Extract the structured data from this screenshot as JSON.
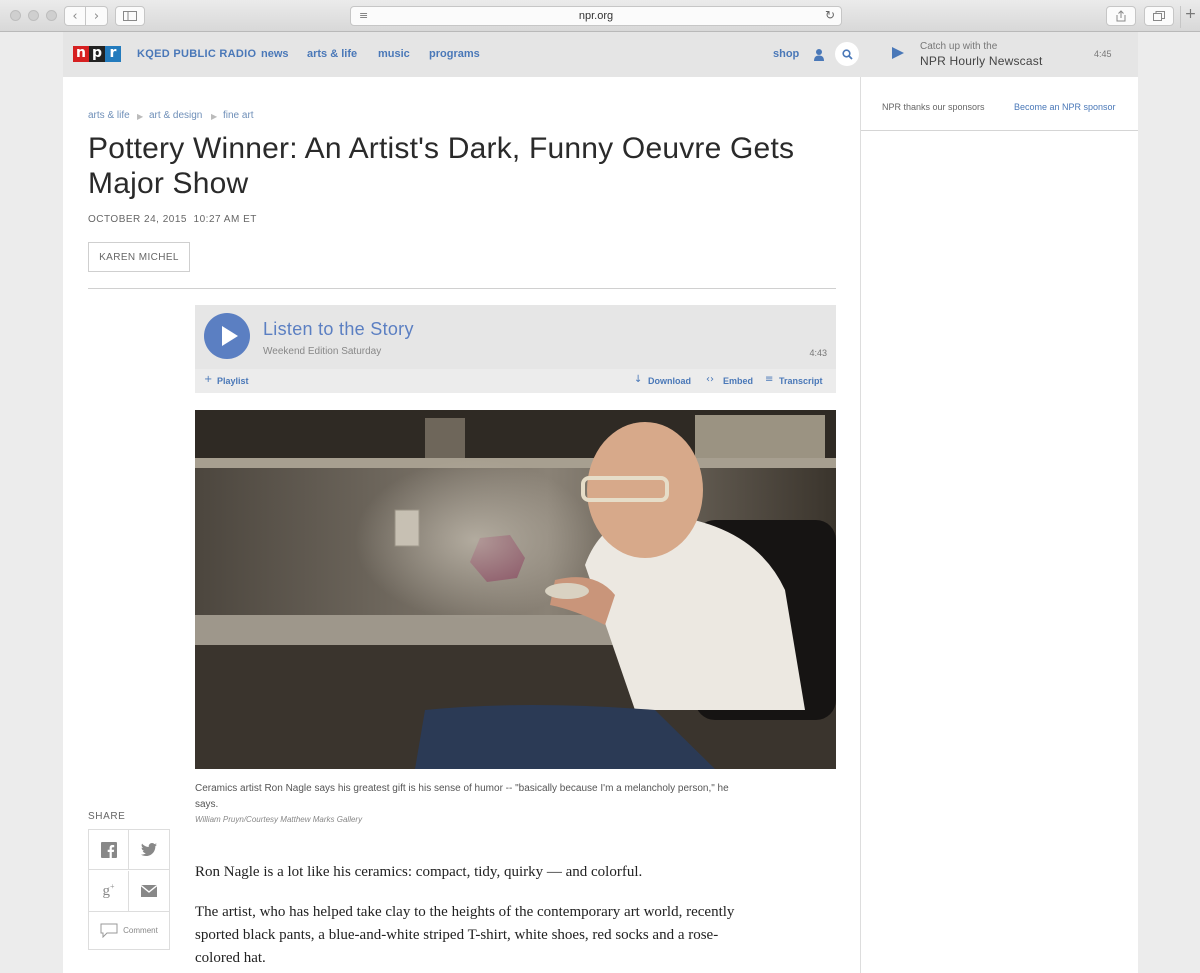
{
  "browser": {
    "url": "npr.org"
  },
  "nav": {
    "station": "KQED PUBLIC RADIO",
    "links": [
      "news",
      "arts & life",
      "music",
      "programs"
    ],
    "shop": "shop",
    "newscast_kicker": "Catch up with the",
    "newscast_title": "NPR Hourly Newscast",
    "newscast_time": "4:45"
  },
  "logo": {
    "n": "n",
    "p": "p",
    "r": "r"
  },
  "sidebar": {
    "sponsor_thanks": "NPR thanks our sponsors",
    "sponsor_link": "Become an NPR sponsor"
  },
  "breadcrumb": [
    "arts & life",
    "art & design",
    "fine art"
  ],
  "article": {
    "headline": "Pottery Winner: An Artist's Dark, Funny Oeuvre Gets Major Show",
    "date": "OCTOBER 24, 2015",
    "time": "10:27 AM ET",
    "byline": "KAREN MICHEL",
    "paragraphs": [
      "Ron Nagle is a lot like his ceramics: compact, tidy, quirky — and colorful.",
      "The artist, who has helped take clay to the heights of the contemporary art world, recently sported black pants, a blue-and-white striped T-shirt, white shoes, red socks and a rose-colored hat."
    ]
  },
  "player": {
    "title": "Listen to the Story",
    "program": "Weekend Edition Saturday",
    "duration": "4:43",
    "playlist": "Playlist",
    "download": "Download",
    "embed": "Embed",
    "transcript": "Transcript"
  },
  "photo": {
    "caption": "Ceramics artist Ron Nagle says his greatest gift is his sense of humor -- \"basically because I'm a melancholy person,\" he says.",
    "credit": "William Pruyn/Courtesy Matthew Marks Gallery"
  },
  "share": {
    "label": "SHARE",
    "comment": "Comment"
  },
  "colors": {
    "npr_red": "#d62021",
    "npr_blue": "#237bbd",
    "link": "#4a78b8",
    "player_blue": "#5b7fc2"
  }
}
